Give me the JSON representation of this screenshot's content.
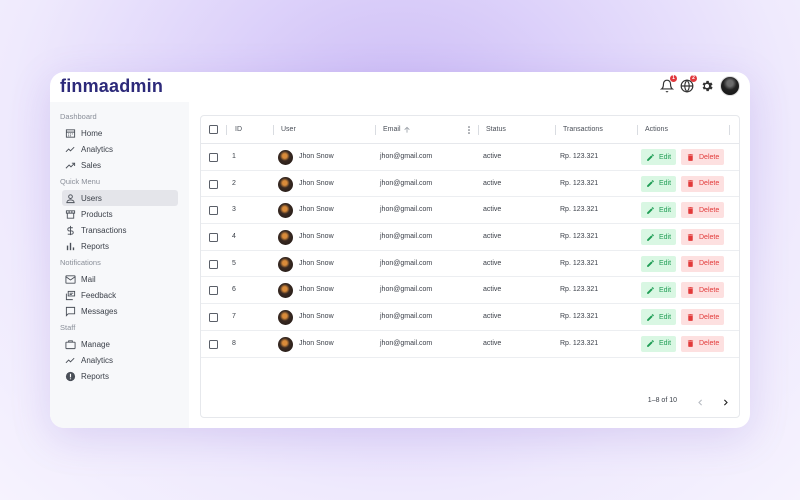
{
  "app": {
    "logo": "finmaadmin"
  },
  "topbar": {
    "icons": [
      "bell-icon",
      "globe-icon",
      "gear-icon"
    ],
    "notification_badge": "1",
    "language_badge": "2"
  },
  "sidebar": {
    "groups": [
      {
        "title": "Dashboard",
        "items": [
          {
            "label": "Home",
            "icon": "home-icon"
          },
          {
            "label": "Analytics",
            "icon": "line-chart-icon"
          },
          {
            "label": "Sales",
            "icon": "trending-up-icon"
          }
        ]
      },
      {
        "title": "Quick Menu",
        "items": [
          {
            "label": "Users",
            "icon": "user-icon",
            "active": true
          },
          {
            "label": "Products",
            "icon": "store-icon"
          },
          {
            "label": "Transactions",
            "icon": "dollar-icon"
          },
          {
            "label": "Reports",
            "icon": "bar-chart-icon"
          }
        ]
      },
      {
        "title": "Notifications",
        "items": [
          {
            "label": "Mail",
            "icon": "mail-icon"
          },
          {
            "label": "Feedback",
            "icon": "feedback-icon"
          },
          {
            "label": "Messages",
            "icon": "message-icon"
          }
        ]
      },
      {
        "title": "Staff",
        "items": [
          {
            "label": "Manage",
            "icon": "briefcase-icon"
          },
          {
            "label": "Analytics",
            "icon": "line-chart-icon"
          },
          {
            "label": "Reports",
            "icon": "alert-circle-icon"
          }
        ]
      }
    ]
  },
  "table": {
    "columns": {
      "id": "ID",
      "user": "User",
      "email": "Email",
      "status": "Status",
      "transactions": "Transactions",
      "actions": "Actions"
    },
    "edit_label": "Edit",
    "delete_label": "Delete",
    "rows": [
      {
        "id": "1",
        "user": "Jhon Snow",
        "email": "jhon@gmail.com",
        "status": "active",
        "transactions": "Rp. 123.321"
      },
      {
        "id": "2",
        "user": "Jhon Snow",
        "email": "jhon@gmail.com",
        "status": "active",
        "transactions": "Rp. 123.321"
      },
      {
        "id": "3",
        "user": "Jhon Snow",
        "email": "jhon@gmail.com",
        "status": "active",
        "transactions": "Rp. 123.321"
      },
      {
        "id": "4",
        "user": "Jhon Snow",
        "email": "jhon@gmail.com",
        "status": "active",
        "transactions": "Rp. 123.321"
      },
      {
        "id": "5",
        "user": "Jhon Snow",
        "email": "jhon@gmail.com",
        "status": "active",
        "transactions": "Rp. 123.321"
      },
      {
        "id": "6",
        "user": "Jhon Snow",
        "email": "jhon@gmail.com",
        "status": "active",
        "transactions": "Rp. 123.321"
      },
      {
        "id": "7",
        "user": "Jhon Snow",
        "email": "jhon@gmail.com",
        "status": "active",
        "transactions": "Rp. 123.321"
      },
      {
        "id": "8",
        "user": "Jhon Snow",
        "email": "jhon@gmail.com",
        "status": "active",
        "transactions": "Rp. 123.321"
      }
    ],
    "pagination": "1–8 of 10"
  },
  "colors": {
    "logo": "#2d2a7a",
    "edit_bg": "#d9f7e3",
    "edit_text": "#1f9d55",
    "delete_bg": "#fde0e0",
    "delete_text": "#e23a3a"
  }
}
